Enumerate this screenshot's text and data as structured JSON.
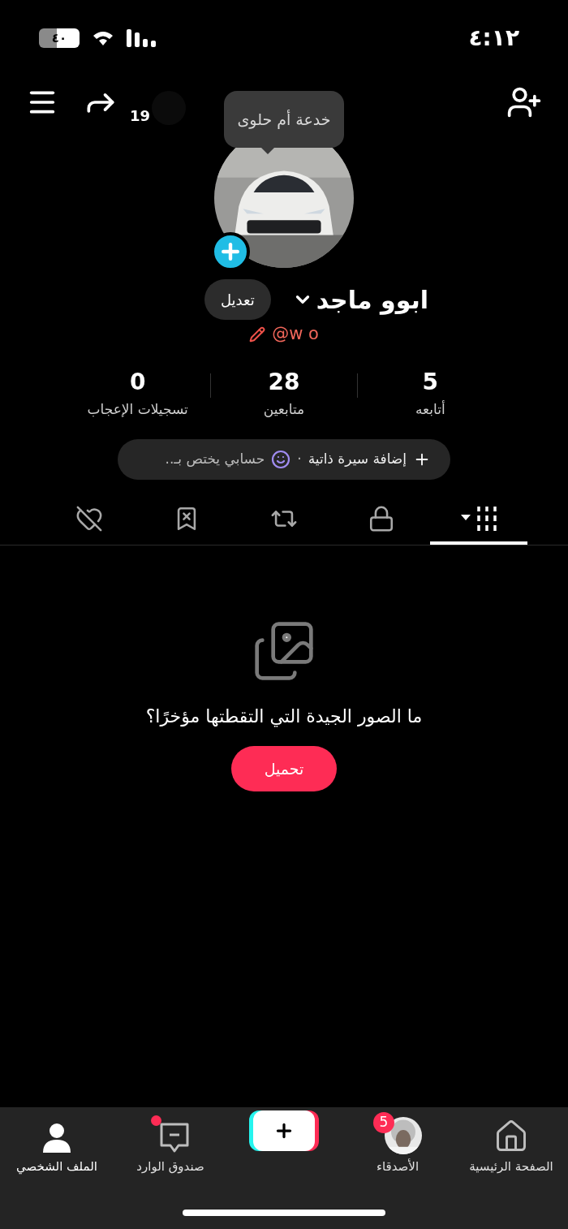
{
  "status_bar": {
    "time": "٤:١٢",
    "battery": "٤٠"
  },
  "top_bar": {
    "share_count": "19"
  },
  "profile": {
    "tooltip": "خدعة أم حلوى",
    "name": "ابوو ماجد",
    "edit_button": "تعديل",
    "handle": "@w o"
  },
  "stats": [
    {
      "value": "5",
      "label": "أتابعه"
    },
    {
      "value": "28",
      "label": "متابعين"
    },
    {
      "value": "0",
      "label": "تسجيلات الإعجاب"
    }
  ],
  "bio": {
    "add_label": "إضافة سيرة ذاتية",
    "separator": "·",
    "suggestion": "حسابي يختص بـ.."
  },
  "tabs": [
    {
      "kind": "videos",
      "selected": true
    },
    {
      "kind": "private",
      "selected": false
    },
    {
      "kind": "reposts",
      "selected": false
    },
    {
      "kind": "saved",
      "selected": false
    },
    {
      "kind": "liked",
      "selected": false
    }
  ],
  "empty_state": {
    "message": "ما الصور الجيدة التي التقطتها مؤخرًا؟",
    "button": "تحميل"
  },
  "nav": [
    {
      "kind": "home",
      "label": "الصفحة الرئيسية",
      "selected": false
    },
    {
      "kind": "friends",
      "label": "الأصدقاء",
      "badge": "5",
      "selected": false
    },
    {
      "kind": "create",
      "selected": false
    },
    {
      "kind": "inbox",
      "label": "صندوق الوارد",
      "unread_dot": true,
      "selected": false
    },
    {
      "kind": "profile",
      "label": "الملف الشخصي",
      "selected": true
    }
  ]
}
